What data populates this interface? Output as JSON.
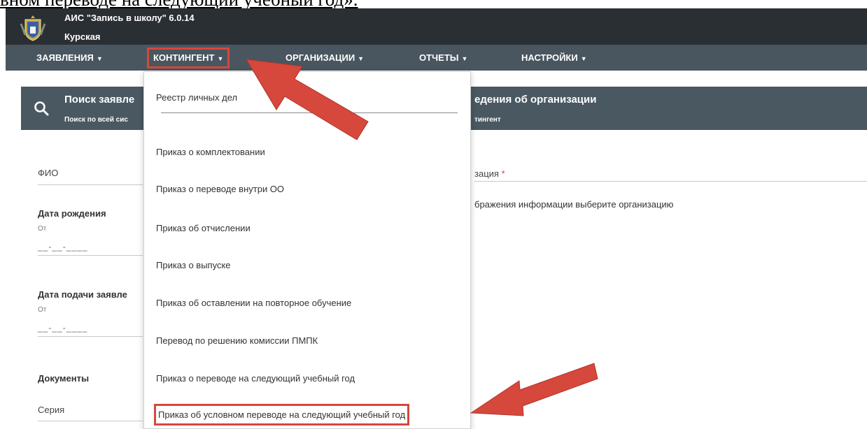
{
  "doc": {
    "top_text": "вном переводе на следующий учебный год»."
  },
  "header": {
    "title": "АИС \"Запись в школу\" 6.0.14",
    "region": "Курская"
  },
  "nav": {
    "items": [
      {
        "label": "ЗАЯВЛЕНИЯ"
      },
      {
        "label": "КОНТИНГЕНТ"
      },
      {
        "label": "ОРГАНИЗАЦИИ"
      },
      {
        "label": "ОТЧЕТЫ"
      },
      {
        "label": "НАСТРОЙКИ"
      }
    ]
  },
  "panel": {
    "left_title": "Поиск заявле",
    "left_sub": "Поиск по всей сис",
    "right_title": "едения об организации",
    "right_sub": "тингент"
  },
  "form": {
    "fio": "ФИО",
    "birth_date": "Дата рождения",
    "from1": "От",
    "date_mask1": "__-__-____",
    "apply_date": "Дата подачи заявле",
    "from2": "От",
    "date_mask2": "__-__-____",
    "documents": "Документы",
    "series": "Серия",
    "org_label": "зация",
    "required_mark": "*",
    "org_hint": "бражения информации выберите организацию"
  },
  "dropdown": {
    "items": [
      {
        "label": "Реестр личных дел"
      },
      {
        "label": "Приказ о комплектовании"
      },
      {
        "label": "Приказ о переводе внутри ОО"
      },
      {
        "label": "Приказ об отчислении"
      },
      {
        "label": "Приказ о выпуске"
      },
      {
        "label": "Приказ об оставлении на повторное обучение"
      },
      {
        "label": "Перевод по решению комиссии ПМПК"
      },
      {
        "label": "Приказ о переводе на следующий учебный год"
      },
      {
        "label": "Приказ об условном переводе на следующий учебный год"
      }
    ]
  },
  "colors": {
    "header_bg": "#2a2f34",
    "nav_bg": "#49565f",
    "panel_bg": "#4a5862",
    "annotation_red": "#d6473c"
  },
  "icons": {
    "logo": "coat-of-arms-icon",
    "search": "search-icon",
    "caret": "caret-down-icon",
    "annotation": "red-arrow"
  }
}
